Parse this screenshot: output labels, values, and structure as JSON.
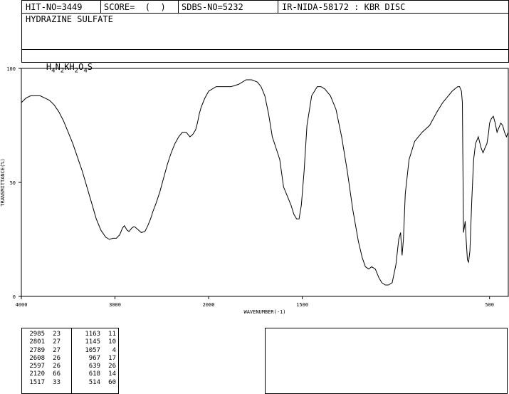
{
  "header": {
    "hit_no": "HIT-NO=3449",
    "score": "SCORE=  (  )",
    "sdbs_no": "SDBS-NO=5232",
    "ir_nida": "IR-NIDA-58172 : KBR DISC",
    "compound_name": "HYDRAZINE SULFATE",
    "formula": {
      "part1": "H",
      "sub1": "4",
      "part2": "N",
      "sub2": "2",
      "part3": "KH",
      "sub3": "2",
      "part4": "O",
      "sub4": "4",
      "part5": "S"
    }
  },
  "chart_data": {
    "type": "line",
    "xlabel": "WAVENUMBER(-1)",
    "ylabel": "TRANSMITTANCE(%)",
    "xlim": [
      4000,
      400
    ],
    "ylim": [
      0,
      100
    ],
    "x_ticks": [
      4000,
      3000,
      2000,
      1500,
      500
    ],
    "x_tick_labels": [
      "4000",
      "3000",
      "2000",
      "1500",
      "500"
    ],
    "y_ticks": [
      0,
      50,
      100
    ],
    "y_tick_labels": [
      "0",
      "50",
      "100"
    ],
    "series": [
      {
        "x": [
          4000,
          3950,
          3900,
          3850,
          3800,
          3750,
          3700,
          3650,
          3600,
          3550,
          3500,
          3450,
          3400,
          3350,
          3300,
          3250,
          3200,
          3150,
          3100,
          3060,
          3020,
          2985,
          2950,
          2920,
          2900,
          2870,
          2850,
          2820,
          2801,
          2789,
          2760,
          2720,
          2680,
          2650,
          2620,
          2608,
          2597,
          2560,
          2520,
          2480,
          2440,
          2400,
          2360,
          2320,
          2280,
          2240,
          2200,
          2170,
          2140,
          2120,
          2100,
          2080,
          2060,
          2040,
          2000,
          1960,
          1920,
          1880,
          1840,
          1800,
          1770,
          1740,
          1720,
          1700,
          1680,
          1660,
          1640,
          1620,
          1600,
          1580,
          1560,
          1545,
          1530,
          1517,
          1505,
          1490,
          1475,
          1450,
          1420,
          1400,
          1380,
          1350,
          1320,
          1290,
          1260,
          1230,
          1200,
          1180,
          1163,
          1145,
          1130,
          1110,
          1090,
          1075,
          1057,
          1040,
          1020,
          1000,
          985,
          975,
          967,
          960,
          950,
          930,
          900,
          860,
          820,
          780,
          750,
          720,
          700,
          685,
          670,
          660,
          650,
          645,
          639,
          630,
          625,
          618,
          612,
          605,
          595,
          585,
          575,
          560,
          545,
          535,
          525,
          514,
          505,
          500,
          490,
          480,
          470,
          460,
          450,
          440,
          430,
          420,
          410,
          400
        ],
        "y": [
          85,
          87,
          88,
          88,
          88,
          87,
          86,
          84,
          81,
          77,
          72,
          67,
          61,
          55,
          48,
          41,
          34,
          29,
          26,
          25,
          25.5,
          25.5,
          27,
          30,
          31,
          29,
          28.5,
          30,
          30.5,
          30.5,
          29.5,
          28,
          28.5,
          31,
          34,
          35.5,
          37,
          41,
          46,
          52,
          58,
          63,
          67,
          70,
          72,
          72,
          70,
          71,
          73,
          76,
          80,
          83,
          85,
          87,
          90,
          92,
          92,
          92,
          93,
          95,
          95,
          94,
          92,
          88,
          80,
          70,
          65,
          60,
          48,
          44,
          40,
          36,
          34,
          34,
          40,
          55,
          75,
          88,
          92,
          92,
          91,
          88,
          82,
          70,
          55,
          38,
          24,
          17,
          13,
          12,
          13,
          12,
          8,
          6,
          5,
          5,
          6,
          14,
          25,
          28,
          18,
          25,
          45,
          60,
          68,
          72,
          75,
          81,
          85,
          88,
          90,
          91,
          92,
          92,
          90,
          85,
          28,
          33,
          25,
          16,
          15,
          20,
          42,
          60,
          67,
          70,
          65,
          63,
          65,
          67,
          72,
          76,
          78,
          79,
          76,
          72,
          74,
          76,
          75,
          72,
          70,
          72
        ]
      }
    ],
    "peak_table": {
      "left": [
        [
          "2985",
          "23"
        ],
        [
          "2801",
          "27"
        ],
        [
          "2789",
          "27"
        ],
        [
          "2608",
          "26"
        ],
        [
          "2597",
          "26"
        ],
        [
          "2120",
          "66"
        ],
        [
          "1517",
          "33"
        ]
      ],
      "right": [
        [
          "1163",
          "11"
        ],
        [
          "1145",
          "10"
        ],
        [
          "1057",
          "4"
        ],
        [
          "967",
          "17"
        ],
        [
          "639",
          "26"
        ],
        [
          "618",
          "14"
        ],
        [
          "514",
          "60"
        ]
      ]
    }
  }
}
